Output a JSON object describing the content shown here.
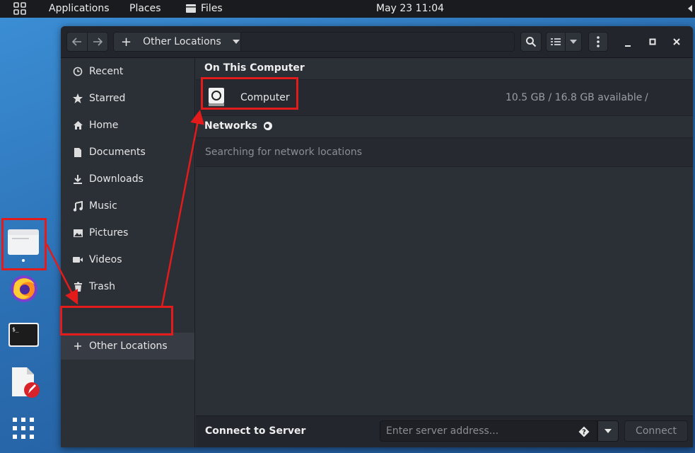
{
  "topbar": {
    "apps_icon": "grid-icon",
    "applications": "Applications",
    "places": "Places",
    "files": "Files",
    "clock": "May 23  11:04"
  },
  "window": {
    "location": "Other Locations",
    "sidebar": [
      {
        "label": "Recent",
        "icon": "clock-icon"
      },
      {
        "label": "Starred",
        "icon": "star-icon"
      },
      {
        "label": "Home",
        "icon": "home-icon"
      },
      {
        "label": "Documents",
        "icon": "document-icon"
      },
      {
        "label": "Downloads",
        "icon": "download-icon"
      },
      {
        "label": "Music",
        "icon": "music-icon"
      },
      {
        "label": "Pictures",
        "icon": "picture-icon"
      },
      {
        "label": "Videos",
        "icon": "video-icon"
      },
      {
        "label": "Trash",
        "icon": "trash-icon"
      },
      {
        "label": "Other Locations",
        "icon": "plus-icon"
      }
    ],
    "on_this_computer": "On This Computer",
    "computer": {
      "name": "Computer",
      "space": "10.5 GB / 16.8 GB available",
      "mount": "/"
    },
    "networks": "Networks",
    "networks_status": "Searching for network locations",
    "connect_to_server": "Connect to Server",
    "server_placeholder": "Enter server address...",
    "connect_button": "Connect"
  },
  "colors": {
    "annotation": "#e31b1b",
    "accent": "#3584e4"
  }
}
